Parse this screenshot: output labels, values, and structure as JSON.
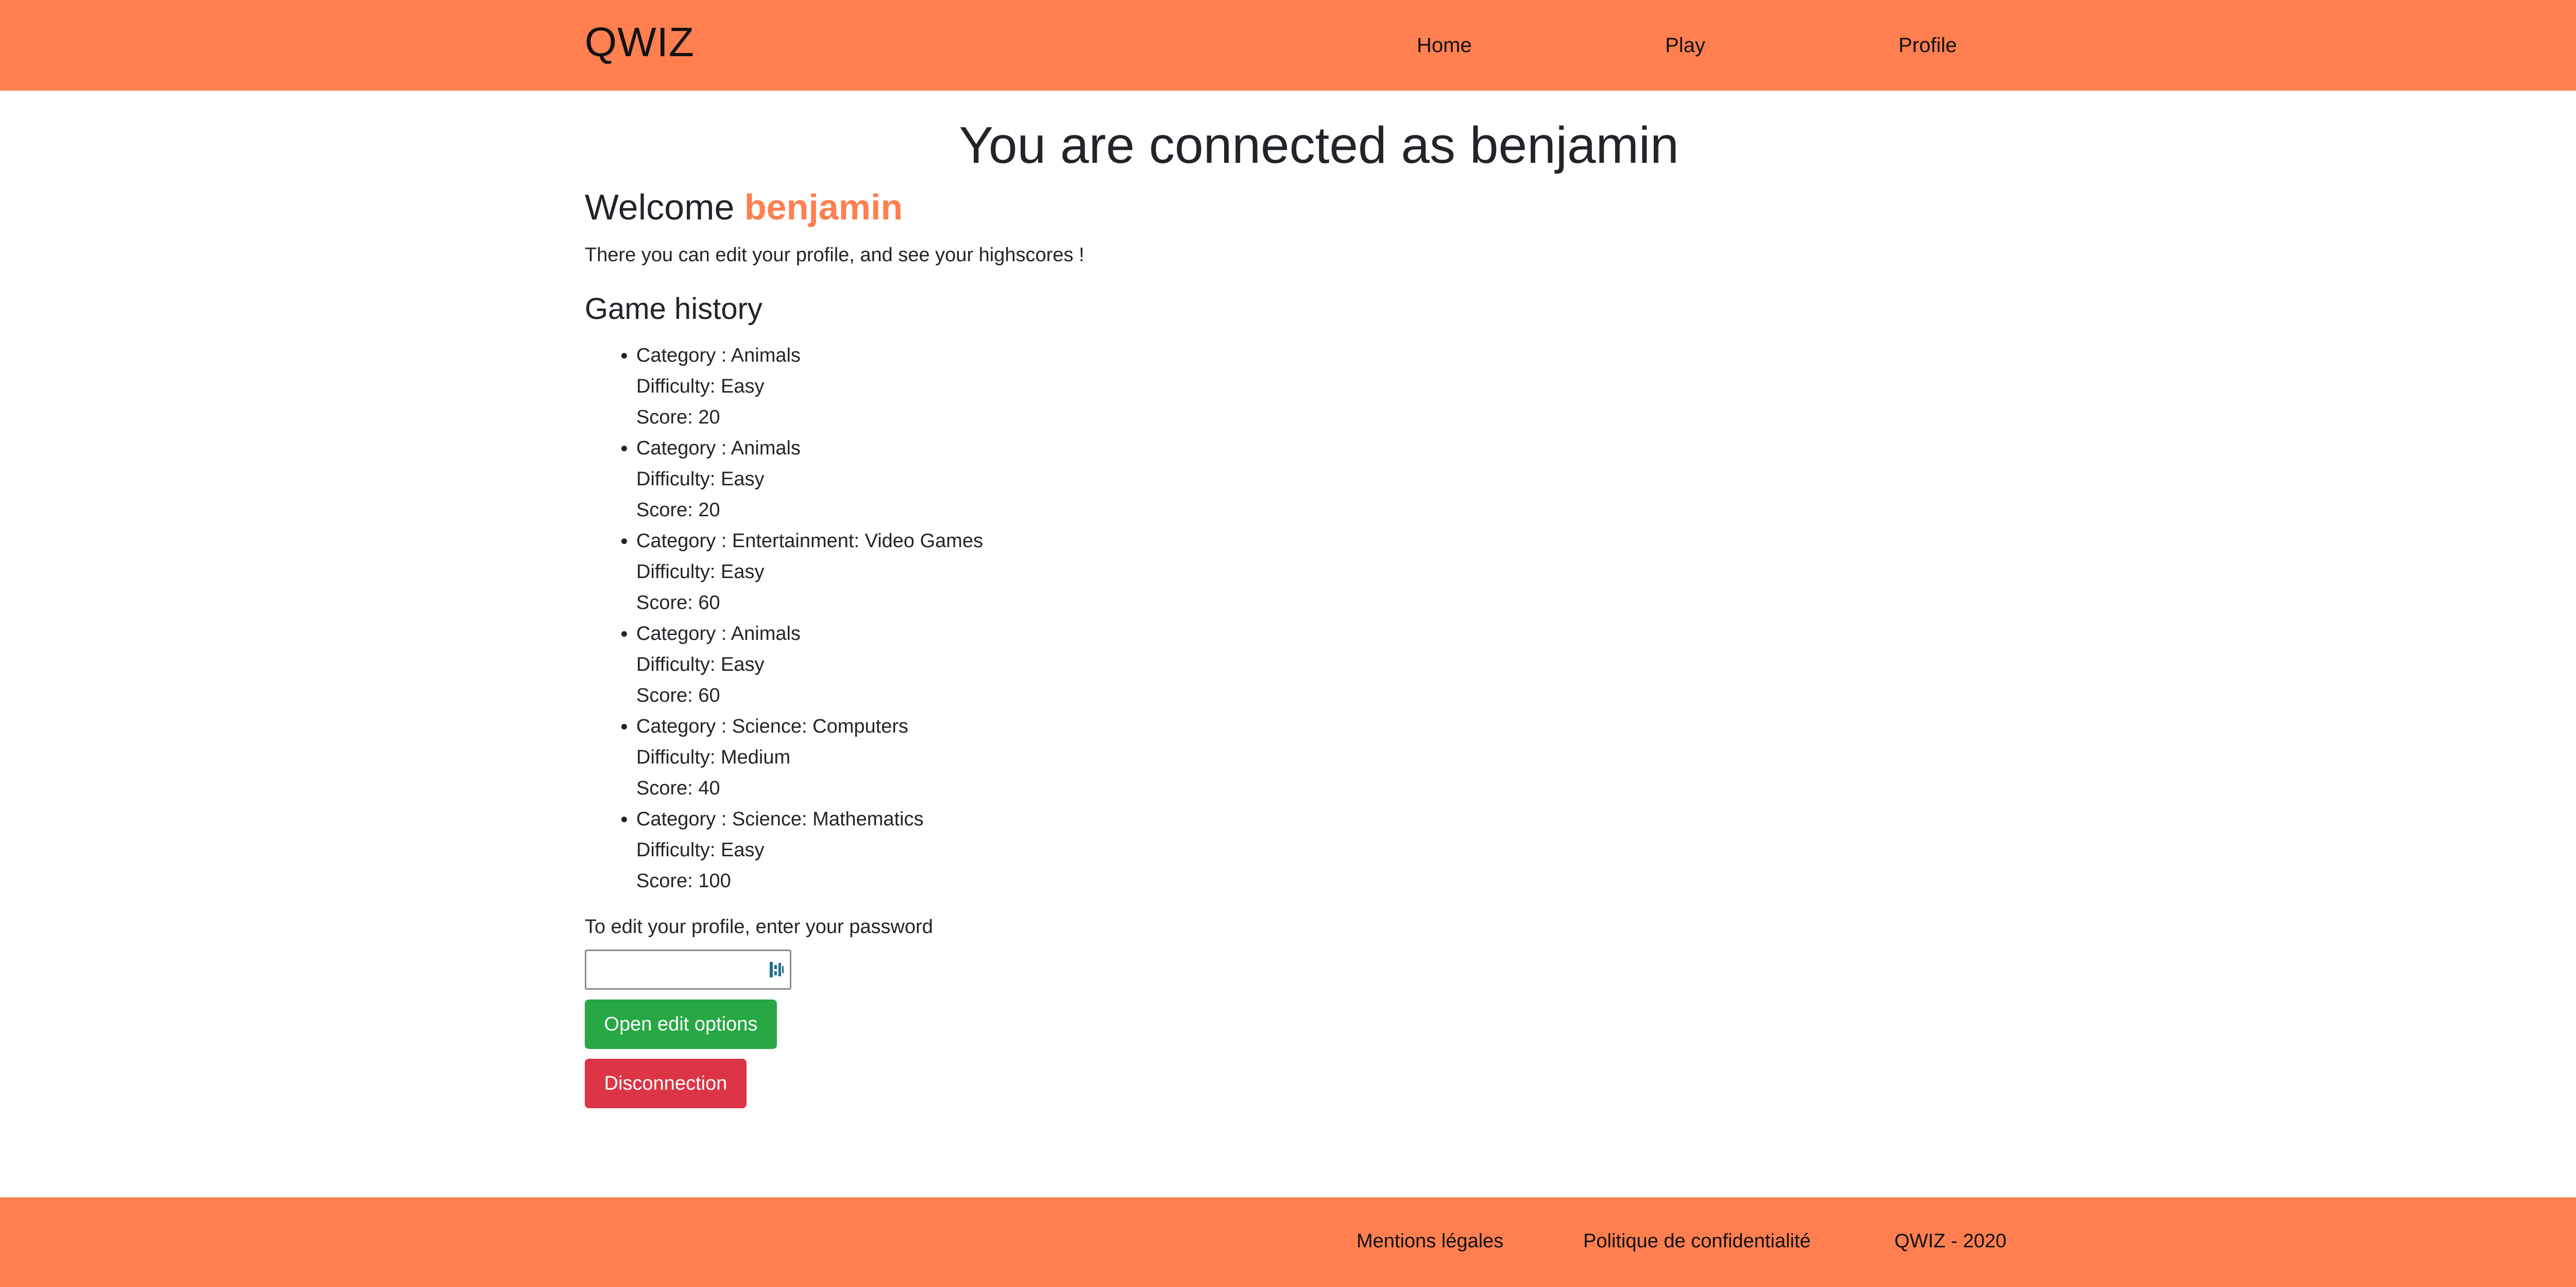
{
  "header": {
    "brand": "QWIZ",
    "nav": {
      "home": "Home",
      "play": "Play",
      "profile": "Profile"
    }
  },
  "main": {
    "title": "You are connected as benjamin",
    "welcome_prefix": "Welcome",
    "username": "benjamin",
    "intro": "There you can edit your profile, and see your highscores !",
    "history_title": "Game history",
    "history": [
      {
        "category": "Category : Animals",
        "difficulty": "Difficulty: Easy",
        "score": "Score: 20"
      },
      {
        "category": "Category : Animals",
        "difficulty": "Difficulty: Easy",
        "score": "Score: 20"
      },
      {
        "category": "Category : Entertainment: Video Games",
        "difficulty": "Difficulty: Easy",
        "score": "Score: 60"
      },
      {
        "category": "Category : Animals",
        "difficulty": "Difficulty: Easy",
        "score": "Score: 60"
      },
      {
        "category": "Category : Science: Computers",
        "difficulty": "Difficulty: Medium",
        "score": "Score: 40"
      },
      {
        "category": "Category : Science: Mathematics",
        "difficulty": "Difficulty: Easy",
        "score": "Score: 100"
      }
    ],
    "password_label": "To edit your profile, enter your password",
    "password_value": "",
    "password_icon": "password-manager-key-icon",
    "edit_button": "Open edit options",
    "disconnect_button": "Disconnection"
  },
  "footer": {
    "legal": "Mentions légales",
    "privacy": "Politique de confidentialité",
    "copyright": "QWIZ - 2020"
  },
  "colors": {
    "brand": "#ff7f50",
    "success": "#28a745",
    "danger": "#dc3545",
    "text": "#212529"
  }
}
